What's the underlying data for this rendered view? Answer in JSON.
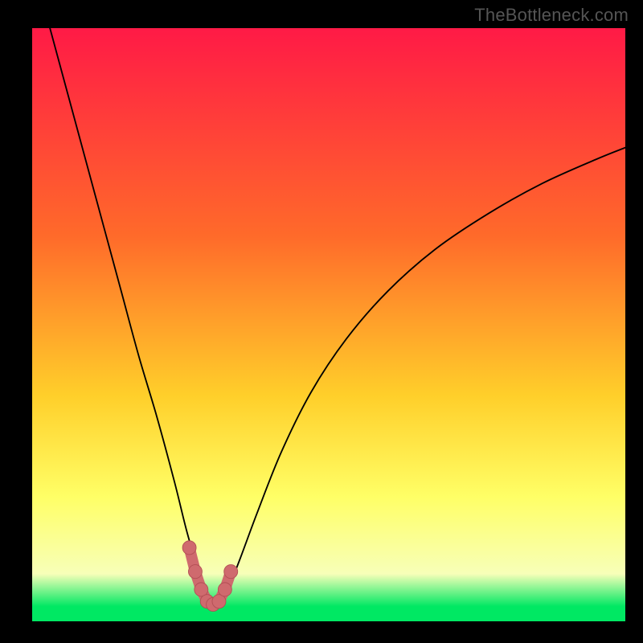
{
  "watermark": {
    "text": "TheBottleneck.com"
  },
  "colors": {
    "black": "#000000",
    "grad_top": "#ff1a46",
    "grad_mid1": "#ff6a2a",
    "grad_mid2": "#ffcf2a",
    "grad_mid3": "#ffff66",
    "grad_pale": "#f7ffb8",
    "grad_green": "#00e863",
    "curve_stroke": "#000000",
    "marker_fill": "#cf6a6e",
    "marker_stroke": "#b24e54"
  },
  "chart_data": {
    "type": "line",
    "title": "",
    "xlabel": "",
    "ylabel": "",
    "xlim": [
      0,
      100
    ],
    "ylim": [
      0,
      100
    ],
    "grid": false,
    "legend": false,
    "series": [
      {
        "name": "bottleneck-curve",
        "x": [
          3,
          6,
          9,
          12,
          15,
          18,
          21,
          24,
          26,
          28,
          29,
          30,
          31,
          32,
          33,
          35,
          38,
          42,
          47,
          53,
          60,
          68,
          77,
          86,
          95,
          100
        ],
        "y": [
          100,
          89,
          78,
          67,
          56,
          45,
          35,
          24,
          16,
          9,
          5,
          3,
          3,
          4,
          6,
          11,
          19,
          29,
          39,
          48,
          56,
          63,
          69,
          74,
          78,
          80
        ]
      }
    ],
    "markers": {
      "name": "highlight-range",
      "x": [
        26.5,
        27.5,
        28.5,
        29.5,
        30.5,
        31.5,
        32.5,
        33.5
      ],
      "y": [
        13,
        9,
        6,
        4,
        3.5,
        4,
        6,
        9
      ]
    },
    "gradient_stops": [
      {
        "offset": 0.0,
        "color_key": "grad_top"
      },
      {
        "offset": 0.35,
        "color_key": "grad_mid1"
      },
      {
        "offset": 0.62,
        "color_key": "grad_mid2"
      },
      {
        "offset": 0.79,
        "color_key": "grad_mid3"
      },
      {
        "offset": 0.92,
        "color_key": "grad_pale"
      },
      {
        "offset": 0.975,
        "color_key": "grad_green"
      },
      {
        "offset": 1.0,
        "color_key": "grad_green"
      }
    ]
  }
}
